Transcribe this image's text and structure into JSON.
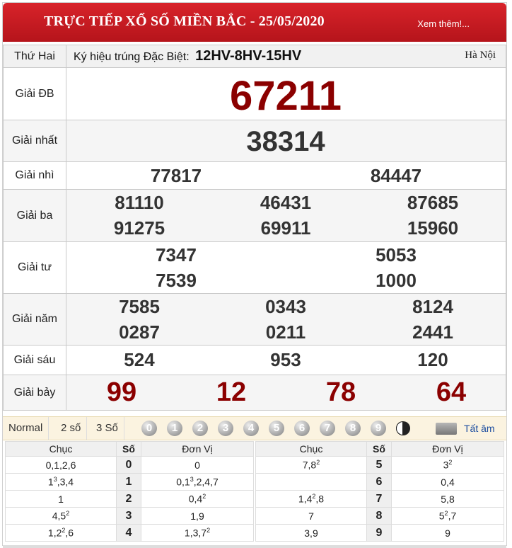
{
  "header": {
    "title": "TRỰC TIẾP XỔ SỐ MIỀN BẮC - 25/05/2020",
    "more_link": "Xem thêm!..."
  },
  "info": {
    "day": "Thứ Hai",
    "code_label": "Ký hiệu trúng Đặc Biệt:",
    "code_value": "12HV-8HV-15HV",
    "location": "Hà Nội"
  },
  "prizes": {
    "db": {
      "label": "Giải ĐB",
      "numbers": [
        "67211"
      ]
    },
    "nhat": {
      "label": "Giải nhất",
      "numbers": [
        "38314"
      ]
    },
    "nhi": {
      "label": "Giải nhì",
      "numbers": [
        "77817",
        "84447"
      ]
    },
    "ba": {
      "label": "Giải ba",
      "numbers": [
        "81110",
        "46431",
        "87685",
        "91275",
        "69911",
        "15960"
      ]
    },
    "tu": {
      "label": "Giải tư",
      "numbers": [
        "7347",
        "5053",
        "7539",
        "1000"
      ]
    },
    "nam": {
      "label": "Giải năm",
      "numbers": [
        "7585",
        "0343",
        "8124",
        "0287",
        "0211",
        "2441"
      ]
    },
    "sau": {
      "label": "Giải sáu",
      "numbers": [
        "524",
        "953",
        "120"
      ]
    },
    "bay": {
      "label": "Giải bảy",
      "numbers": [
        "99",
        "12",
        "78",
        "64"
      ]
    }
  },
  "filter": {
    "tabs": [
      "Normal",
      "2 số",
      "3 Số"
    ],
    "digits": [
      "0",
      "1",
      "2",
      "3",
      "4",
      "5",
      "6",
      "7",
      "8",
      "9"
    ],
    "mute_label": "Tất âm"
  },
  "loto": {
    "headers": {
      "chuc": "Chục",
      "so": "Số",
      "donvi": "Đơn Vị"
    },
    "left": [
      {
        "chuc": "0,1,2,6",
        "so": "0",
        "donvi": "0"
      },
      {
        "chuc": "1<sup>3</sup>,3,4",
        "so": "1",
        "donvi": "0,1<sup>3</sup>,2,4,7"
      },
      {
        "chuc": "1",
        "so": "2",
        "donvi": "0,4<sup>2</sup>"
      },
      {
        "chuc": "4,5<sup>2</sup>",
        "so": "3",
        "donvi": "1,9"
      },
      {
        "chuc": "1,2<sup>2</sup>,6",
        "so": "4",
        "donvi": "1,3,7<sup>2</sup>"
      }
    ],
    "right": [
      {
        "chuc": "7,8<sup>2</sup>",
        "so": "5",
        "donvi": "3<sup>2</sup>"
      },
      {
        "chuc": "",
        "so": "6",
        "donvi": "0,4"
      },
      {
        "chuc": "1,4<sup>2</sup>,8",
        "so": "7",
        "donvi": "5,8"
      },
      {
        "chuc": "7",
        "so": "8",
        "donvi": "5<sup>2</sup>,7"
      },
      {
        "chuc": "3,9",
        "so": "9",
        "donvi": "9"
      }
    ]
  }
}
